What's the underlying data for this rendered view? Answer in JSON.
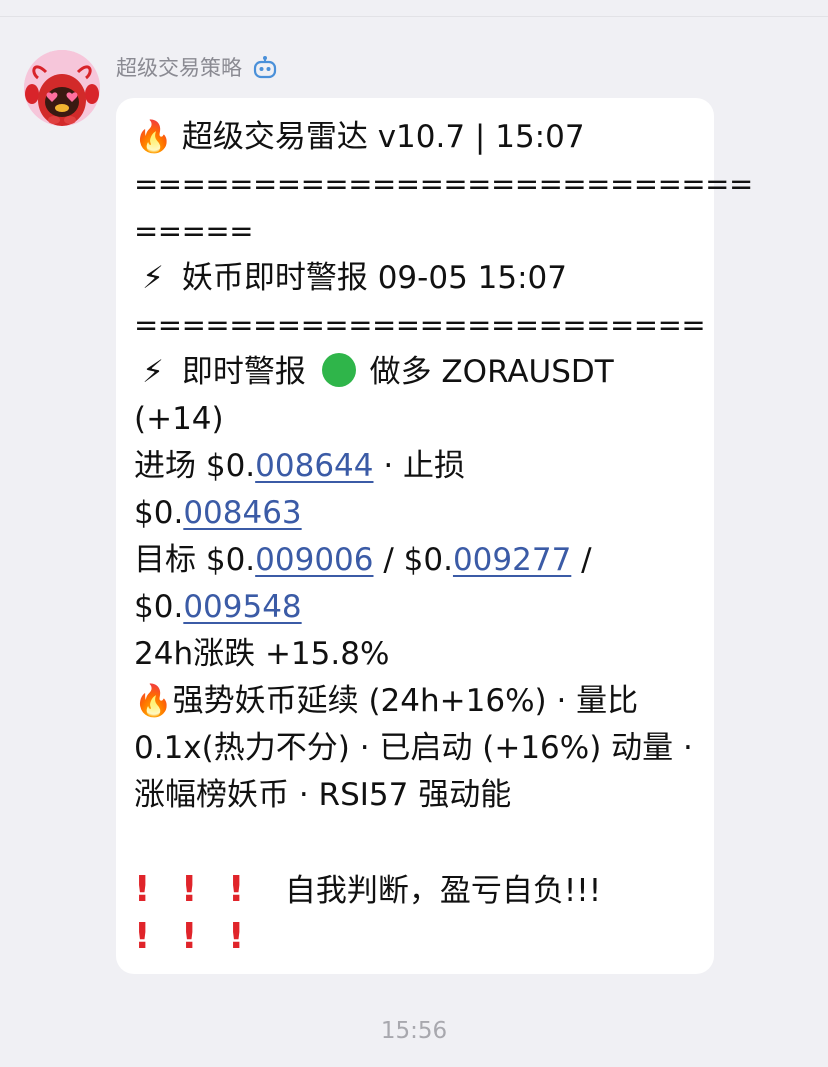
{
  "chat": {
    "sender_name": "超级交易策略",
    "sender_badge_icon": "bot-icon",
    "avatar_icon": "lobster-mascot-avatar",
    "timestamp": "15:56"
  },
  "message": {
    "header_icon": "🔥",
    "header": "超级交易雷达 v10.7 | 15:07",
    "separator_1a": "==========================",
    "separator_1b": "=====",
    "alert_icon": "⚡",
    "alert_title": "妖币即时警报 09-05 15:07",
    "separator_2": "========================",
    "signal_icon": "⚡",
    "signal_label": "即时警报",
    "signal_dot_color": "#2fb54a",
    "signal_text": "做多 ZORAUSDT",
    "signal_score": "(+14)",
    "entry_label": "进场 $0.",
    "entry_value": "008644",
    "stop_label": " · 止损",
    "stop_prefix": "$0.",
    "stop_value": "008463",
    "target_label": "目标 $0.",
    "target_1": "009006",
    "target_sep_1": " / $0.",
    "target_2": "009277",
    "target_sep_2": " /",
    "target_3_prefix": "$0.",
    "target_3": "009548",
    "change_24h": "24h涨跌 +15.8%",
    "trend_icon": "🔥",
    "trend_text": "强势妖币延续 (24h+16%) · 量比 0.1x(热力不分) · 已启动 (+16%) 动量 · 涨幅榜妖币 · RSI57 强动能",
    "warning_marks": "!!!",
    "warning_text": "自我判断，盈亏自负!!!",
    "warning_marks_2": "!!!"
  }
}
